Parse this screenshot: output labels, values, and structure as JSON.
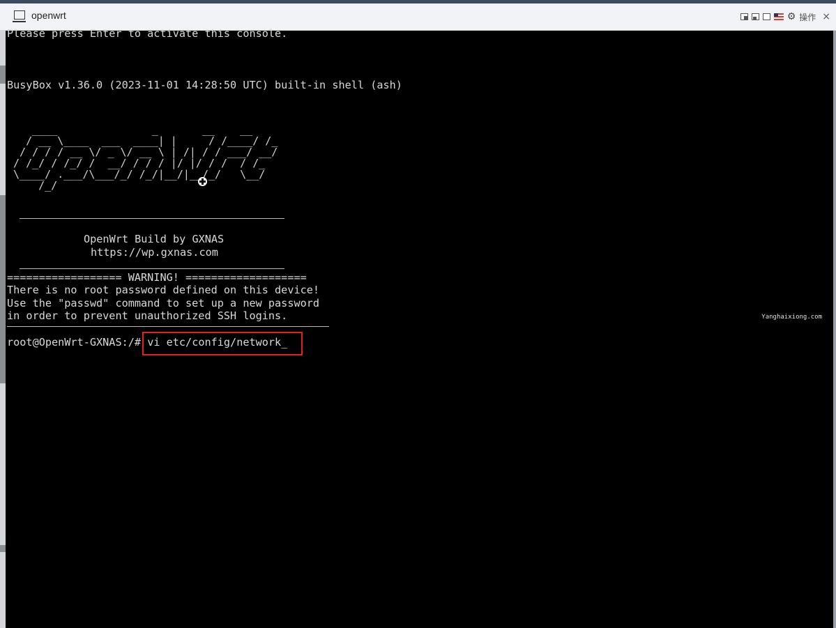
{
  "window": {
    "title": "openwrt",
    "toolbar_ops_label": "操作",
    "close_label": "×"
  },
  "console": {
    "line_press_enter": "Please press Enter to activate this console.",
    "line_busybox": "BusyBox v1.36.0 (2023-11-01 14:28:50 UTC) built-in shell (ash)",
    "ascii_art": "    ____               _       __    __\n   / __ \\____  ___  ____| |     / /____/ /_\n  / / / / __ \\/ _ \\/ __ \\ | /| / / ___/ __/\n / /_/ / /_/ /  __/ / / / |/ |/ / /  / /_\n \\____/ .___/\\___/_/ /_/|__/|__/_/   \\__/\n     /_/",
    "build_by": "OpenWrt Build by GXNAS",
    "build_url": "https://wp.gxnas.com",
    "warning_header": "================== WARNING! ===================",
    "warning_line1": "There is no root password defined on this device!",
    "warning_line2": "Use the \"passwd\" command to set up a new password",
    "warning_line3": "in order to prevent unauthorized SSH logins.",
    "warning_footer": "--------------------------------------------------",
    "prompt": "root@OpenWrt-GXNAS:/#",
    "command": "vi etc/config/network",
    "watermark": "Yanghaixiong.com"
  },
  "colors": {
    "highlight_box": "#e3201b",
    "console_bg": "#000000",
    "console_fg": "#d8d8d8"
  }
}
